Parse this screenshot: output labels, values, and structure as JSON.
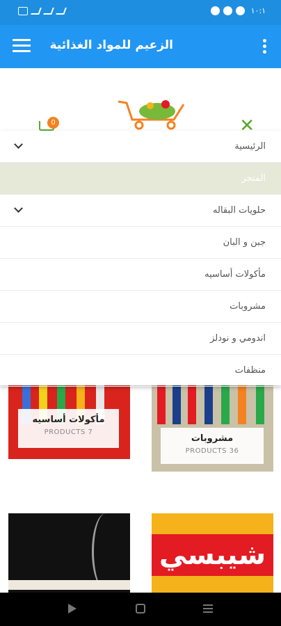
{
  "status_bar": {
    "time": "١٠:١"
  },
  "app_bar": {
    "title": "الزعيم للمواد الغذائية"
  },
  "header": {
    "cart_count": "0"
  },
  "menu": {
    "items": [
      {
        "label": "الرئيسية",
        "has_submenu": true,
        "active": false
      },
      {
        "label": "المتجر",
        "has_submenu": false,
        "active": true
      },
      {
        "label": "حلويات البقاله",
        "has_submenu": true,
        "active": false
      },
      {
        "label": "جبن و البان",
        "has_submenu": false,
        "active": false
      },
      {
        "label": "مأكولات أساسيه",
        "has_submenu": false,
        "active": false
      },
      {
        "label": "مشروبات",
        "has_submenu": false,
        "active": false
      },
      {
        "label": "اندومي و نودلز",
        "has_submenu": false,
        "active": false
      },
      {
        "label": "منظفات",
        "has_submenu": false,
        "active": false
      }
    ]
  },
  "categories": [
    {
      "title": "مأكولات أساسيه",
      "products": "PRODUCTS 7"
    },
    {
      "title": "مشروبات",
      "products": "PRODUCTS 36"
    }
  ],
  "colors": {
    "primary": "#2196f3",
    "accent": "#5aa82e",
    "badge": "#f58220",
    "active_row": "#e6e9d8"
  }
}
